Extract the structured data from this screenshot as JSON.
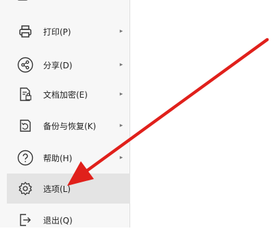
{
  "menu": {
    "items": [
      {
        "label": "打印(P)",
        "icon": "printer-icon",
        "chevron": "▸"
      },
      {
        "label": "分享(D)",
        "icon": "share-icon",
        "chevron": "▸"
      },
      {
        "label": "文档加密(E)",
        "icon": "document-encrypt-icon",
        "chevron": "▸"
      },
      {
        "label": "备份与恢复(K)",
        "icon": "backup-restore-icon",
        "chevron": "▸"
      },
      {
        "label": "帮助(H)",
        "icon": "help-icon",
        "chevron": "▸"
      },
      {
        "label": "选项(L)",
        "icon": "gear-icon",
        "chevron": ""
      },
      {
        "label": "退出(Q)",
        "icon": "exit-icon",
        "chevron": ""
      }
    ]
  },
  "annotation": {
    "arrow_color": "#e0201b",
    "target": "选项(L)"
  }
}
